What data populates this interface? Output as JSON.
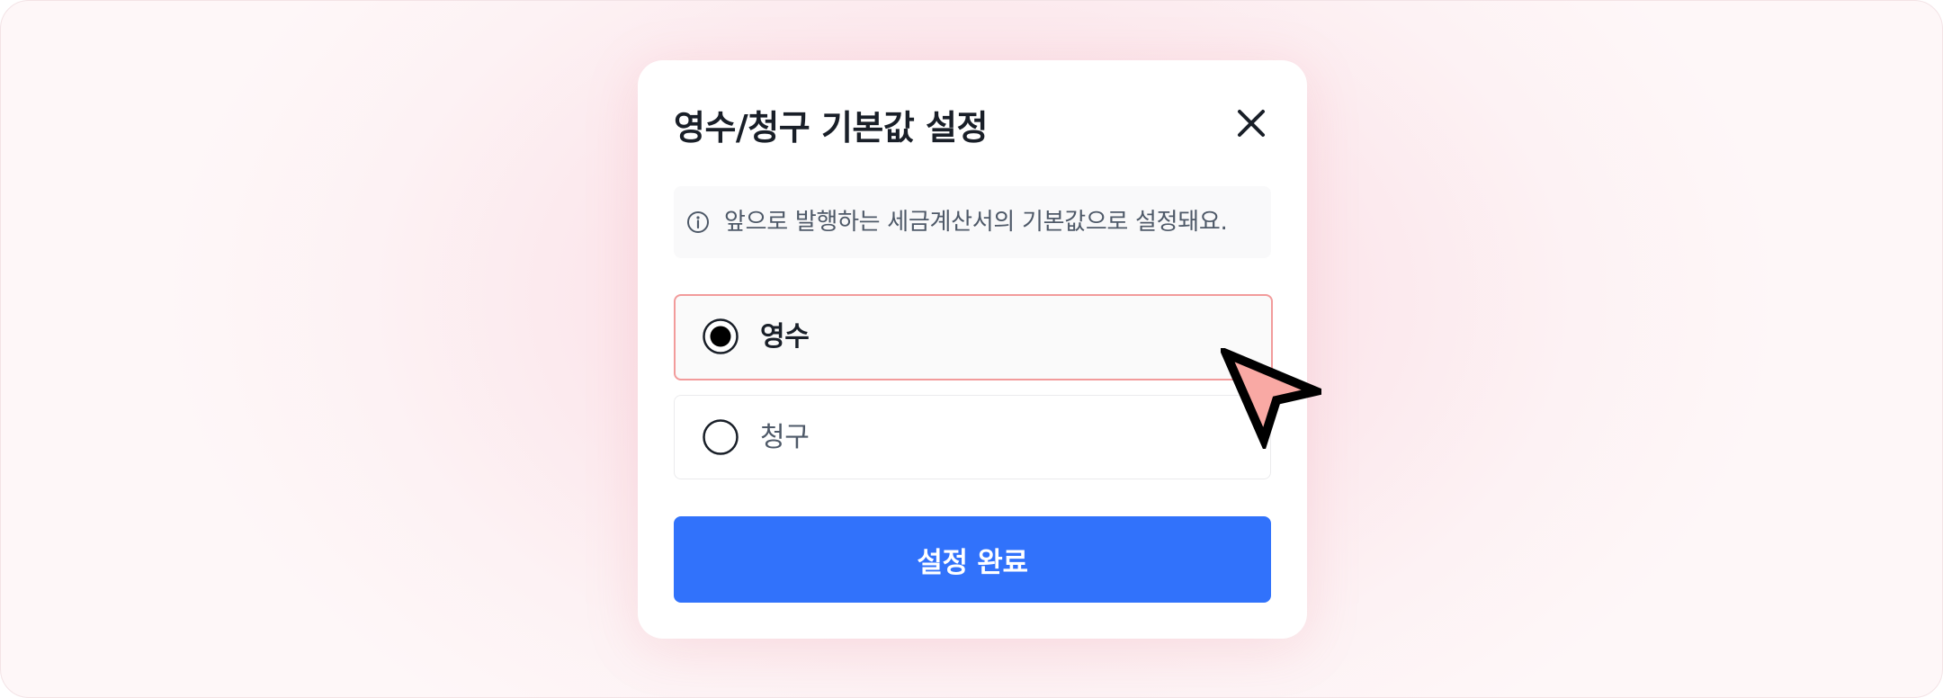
{
  "dialog": {
    "title": "영수/청구 기본값 설정",
    "close_icon": "close-icon",
    "notice": {
      "icon": "info-icon",
      "text": "앞으로 발행하는 세금계산서의 기본값으로 설정돼요."
    },
    "options": [
      {
        "label": "영수",
        "selected": true
      },
      {
        "label": "청구",
        "selected": false
      }
    ],
    "confirm_label": "설정 완료"
  },
  "colors": {
    "accent": "#3172fb",
    "selected_border": "#f29b9b",
    "cursor_fill": "#f9a9a4",
    "title_text": "#191f28",
    "muted_text": "#4e5968"
  },
  "overlay": {
    "cursor_icon": "pointer-cursor-icon"
  }
}
